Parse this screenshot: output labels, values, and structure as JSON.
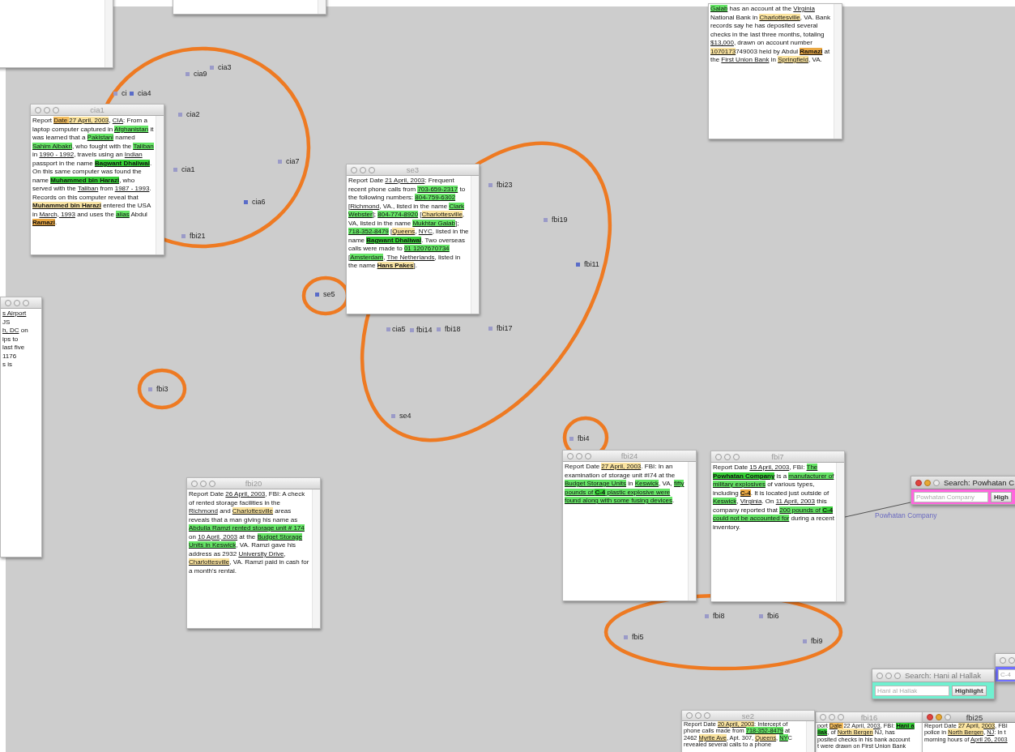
{
  "documents": [
    {
      "kind": "blank"
    },
    {
      "kind": "blank"
    },
    {
      "kind": "report",
      "segments": [
        {
          "text": "Galab",
          "kind": "green"
        },
        {
          "text": " has an account at the ",
          "kind": "plain"
        },
        {
          "text": "Virginia",
          "kind": "entity"
        },
        {
          "text": " National Bank in ",
          "kind": "plain"
        },
        {
          "text": "Charlottesville",
          "kind": "yellow"
        },
        {
          "text": ", VA. Bank records say he has deposited several checks in the last three months, totaling ",
          "kind": "plain"
        },
        {
          "text": "$13,000",
          "kind": "entity"
        },
        {
          "text": ", drawn on account number ",
          "kind": "plain"
        },
        {
          "text": "1070173",
          "kind": "yellow"
        },
        {
          "text": "749003 held by Abdul ",
          "kind": "plain"
        },
        {
          "text": "Ramazi",
          "kind": "orange-bold"
        },
        {
          "text": " at the ",
          "kind": "plain"
        },
        {
          "text": "First Union Bank",
          "kind": "entity"
        },
        {
          "text": " in ",
          "kind": "plain"
        },
        {
          "text": "Springfield",
          "kind": "yellow"
        },
        {
          "text": ", VA.",
          "kind": "plain"
        }
      ]
    },
    {
      "kind": "report",
      "title": "cia1",
      "active": false,
      "segments": [
        {
          "text": "Report ",
          "kind": "plain"
        },
        {
          "text": "Date ",
          "kind": "orange"
        },
        {
          "text": "27 April, 2003",
          "kind": "yellow"
        },
        {
          "text": ", ",
          "kind": "plain"
        },
        {
          "text": "CIA",
          "kind": "entity"
        },
        {
          "text": ": From a laptop computer captured in ",
          "kind": "plain"
        },
        {
          "text": "Afghanistan",
          "kind": "green"
        },
        {
          "text": " it was learned that a ",
          "kind": "plain"
        },
        {
          "text": "Pakistani",
          "kind": "green"
        },
        {
          "text": " named ",
          "kind": "plain"
        },
        {
          "text": "Sahim Albakri",
          "kind": "green"
        },
        {
          "text": ", who fought with the ",
          "kind": "plain"
        },
        {
          "text": "Taliban",
          "kind": "green"
        },
        {
          "text": " in ",
          "kind": "plain"
        },
        {
          "text": "1990 - 1992",
          "kind": "entity"
        },
        {
          "text": ", travels using an ",
          "kind": "plain"
        },
        {
          "text": "Indian",
          "kind": "entity"
        },
        {
          "text": " passport in the name ",
          "kind": "plain"
        },
        {
          "text": "Bagwant Dhaliwal",
          "kind": "green-bold"
        },
        {
          "text": ". On this same computer was found the name ",
          "kind": "plain"
        },
        {
          "text": "Muhammed bin Harazi",
          "kind": "green-bold"
        },
        {
          "text": ", who served with the ",
          "kind": "plain"
        },
        {
          "text": "Taliban",
          "kind": "entity"
        },
        {
          "text": " from ",
          "kind": "plain"
        },
        {
          "text": "1987 - 1993",
          "kind": "entity"
        },
        {
          "text": ". Records on this computer reveal that ",
          "kind": "plain"
        },
        {
          "text": "Muhammed bin Harazi",
          "kind": "yellow-bold"
        },
        {
          "text": " entered the USA in ",
          "kind": "plain"
        },
        {
          "text": "March, 1993",
          "kind": "entity"
        },
        {
          "text": " and uses the ",
          "kind": "plain"
        },
        {
          "text": "alias",
          "kind": "green"
        },
        {
          "text": " Abdul ",
          "kind": "plain"
        },
        {
          "text": "Ramazi",
          "kind": "orange-bold"
        },
        {
          "text": ".",
          "kind": "plain"
        }
      ]
    },
    {
      "kind": "report",
      "title": "se3",
      "active": false,
      "segments": [
        {
          "text": "Report Date ",
          "kind": "plain"
        },
        {
          "text": "21 April, 2003",
          "kind": "entity"
        },
        {
          "text": ": Frequent recent phone calls from ",
          "kind": "plain"
        },
        {
          "text": "703-659-2317",
          "kind": "green"
        },
        {
          "text": " to the following numbers: ",
          "kind": "plain"
        },
        {
          "text": "804-759-6302",
          "kind": "green"
        },
        {
          "text": " [",
          "kind": "plain"
        },
        {
          "text": "Richmond",
          "kind": "entity"
        },
        {
          "text": ", VA., listed in the name ",
          "kind": "plain"
        },
        {
          "text": "Clark Webster",
          "kind": "green"
        },
        {
          "text": "]; ",
          "kind": "plain"
        },
        {
          "text": "804-774-8920",
          "kind": "green"
        },
        {
          "text": " [",
          "kind": "plain"
        },
        {
          "text": "Charlottesville",
          "kind": "yellow"
        },
        {
          "text": ", VA, listed in the name ",
          "kind": "plain"
        },
        {
          "text": "Mukhtar Galab",
          "kind": "green"
        },
        {
          "text": "]; ",
          "kind": "plain"
        },
        {
          "text": "718-352-8479",
          "kind": "green"
        },
        {
          "text": " [",
          "kind": "plain"
        },
        {
          "text": "Queens",
          "kind": "yellow"
        },
        {
          "text": ", ",
          "kind": "plain"
        },
        {
          "text": "NYC",
          "kind": "entity"
        },
        {
          "text": ", listed in the name ",
          "kind": "plain"
        },
        {
          "text": "Bagwant Dhaliwal",
          "kind": "green-bold"
        },
        {
          "text": ". Two overseas calls were made to ",
          "kind": "plain"
        },
        {
          "text": "01 1207670734",
          "kind": "green"
        },
        {
          "text": " [",
          "kind": "plain"
        },
        {
          "text": "Amsterdam",
          "kind": "green"
        },
        {
          "text": ", ",
          "kind": "plain"
        },
        {
          "text": "The Netherlands",
          "kind": "entity"
        },
        {
          "text": ", listed in the name ",
          "kind": "plain"
        },
        {
          "text": "Hans Pakes",
          "kind": "yellow-bold"
        },
        {
          "text": "].",
          "kind": "plain"
        }
      ]
    },
    {
      "kind": "clipped",
      "active": false,
      "lines": [
        [
          {
            "text": "s Airport",
            "kind": "entity"
          }
        ],
        [
          {
            "text": "JS",
            "kind": "plain"
          }
        ],
        [
          {
            "text": "h, DC",
            "kind": "entity"
          },
          {
            "text": " on",
            "kind": "plain"
          }
        ],
        [
          {
            "text": "ips to",
            "kind": "plain"
          }
        ],
        [
          {
            "text": "last five",
            "kind": "plain"
          }
        ],
        [
          {
            "text": "1176",
            "kind": "plain"
          }
        ],
        [
          {
            "text": "s is",
            "kind": "plain"
          }
        ]
      ]
    },
    {
      "kind": "report",
      "title": "fbi20",
      "active": false,
      "segments": [
        {
          "text": "Report Date ",
          "kind": "plain"
        },
        {
          "text": "26 April, 2003",
          "kind": "entity"
        },
        {
          "text": ", FBI: A check of rented storage facilities in the ",
          "kind": "plain"
        },
        {
          "text": "Richmond",
          "kind": "entity"
        },
        {
          "text": " and ",
          "kind": "plain"
        },
        {
          "text": "Charlottesville",
          "kind": "yellow"
        },
        {
          "text": " areas reveals that a man giving his name as ",
          "kind": "plain"
        },
        {
          "text": "Abdulla Ramzi rented storage unit # 174",
          "kind": "green"
        },
        {
          "text": " on ",
          "kind": "plain"
        },
        {
          "text": "10 April, 2003",
          "kind": "entity"
        },
        {
          "text": " at the ",
          "kind": "plain"
        },
        {
          "text": "Budget Storage Units in Keswick",
          "kind": "green"
        },
        {
          "text": ", VA. Ramzi gave his address as 2932 ",
          "kind": "plain"
        },
        {
          "text": "University Drive",
          "kind": "entity"
        },
        {
          "text": ", ",
          "kind": "plain"
        },
        {
          "text": "Charlottesville",
          "kind": "yellow"
        },
        {
          "text": ", VA. Ramzi paid in cash for a month's rental.",
          "kind": "plain"
        }
      ]
    },
    {
      "kind": "report",
      "title": "fbi24",
      "active": false,
      "segments": [
        {
          "text": "Report Date ",
          "kind": "plain"
        },
        {
          "text": "27 April, 2003",
          "kind": "yellow"
        },
        {
          "text": ". FBI: In an examination of storage unit #I74 at the ",
          "kind": "plain"
        },
        {
          "text": "Budget Storage Units",
          "kind": "green"
        },
        {
          "text": " in ",
          "kind": "plain"
        },
        {
          "text": "Keswick",
          "kind": "green"
        },
        {
          "text": ", VA, ",
          "kind": "plain"
        },
        {
          "text": "fifty pounds of ",
          "kind": "green"
        },
        {
          "text": "C-4",
          "kind": "green-bold"
        },
        {
          "text": " plastic explosive were found along with some fusing devices",
          "kind": "green"
        },
        {
          "text": ".",
          "kind": "plain"
        }
      ]
    },
    {
      "kind": "report",
      "title": "fbi7",
      "active": false,
      "segments": [
        {
          "text": "Report Date ",
          "kind": "plain"
        },
        {
          "text": "15 April, 2003",
          "kind": "entity"
        },
        {
          "text": ", FBI: ",
          "kind": "plain"
        },
        {
          "text": "The ",
          "kind": "green"
        },
        {
          "text": "Powhatan Company",
          "kind": "green-bold"
        },
        {
          "text": " is a ",
          "kind": "plain"
        },
        {
          "text": "manufacturer of military explosives",
          "kind": "green"
        },
        {
          "text": " of various types, including ",
          "kind": "plain"
        },
        {
          "text": "C-4",
          "kind": "orange-bold"
        },
        {
          "text": ". It is located just outside of ",
          "kind": "plain"
        },
        {
          "text": "Keswick",
          "kind": "green"
        },
        {
          "text": ", ",
          "kind": "plain"
        },
        {
          "text": "Virginia",
          "kind": "entity"
        },
        {
          "text": ". On ",
          "kind": "plain"
        },
        {
          "text": "11 April, 2003",
          "kind": "entity"
        },
        {
          "text": " this company reported that ",
          "kind": "plain"
        },
        {
          "text": "200 pounds of ",
          "kind": "green"
        },
        {
          "text": "C-4",
          "kind": "green-bold"
        },
        {
          "text": " could not be accounted for",
          "kind": "green"
        },
        {
          "text": " during a recent inventory.",
          "kind": "plain"
        }
      ]
    },
    {
      "kind": "report",
      "title": "se2",
      "active": false,
      "segments": [
        {
          "text": "Report Date ",
          "kind": "plain"
        },
        {
          "text": "20 April, 2003",
          "kind": "yellow"
        },
        {
          "text": ": Intercept of phone calls made from ",
          "kind": "plain"
        },
        {
          "text": "718-352-8479",
          "kind": "green"
        },
        {
          "text": " at 2462 ",
          "kind": "plain"
        },
        {
          "text": "Myrtle Ave",
          "kind": "yellow"
        },
        {
          "text": ", Apt. 307, ",
          "kind": "plain"
        },
        {
          "text": "Queens",
          "kind": "yellow"
        },
        {
          "text": ", ",
          "kind": "plain"
        },
        {
          "text": "NY",
          "kind": "green"
        },
        {
          "text": "C revealed several calls to a phone",
          "kind": "plain"
        }
      ]
    },
    {
      "kind": "clipped",
      "title": "fbi16",
      "active": false,
      "lines": [
        [
          {
            "text": "port ",
            "kind": "plain"
          },
          {
            "text": "Date ",
            "kind": "orange"
          },
          {
            "text": "22 April, 2003",
            "kind": "entity"
          },
          {
            "text": ", FBI: ",
            "kind": "plain"
          },
          {
            "text": "Hani a",
            "kind": "green-bold"
          }
        ],
        [
          {
            "text": "llak",
            "kind": "green-bold"
          },
          {
            "text": ", of ",
            "kind": "plain"
          },
          {
            "text": "North Bergen",
            "kind": "yellow"
          },
          {
            "text": " NJ, has",
            "kind": "plain"
          }
        ],
        [
          {
            "text": "posited checks in his bank account",
            "kind": "plain"
          }
        ],
        [
          {
            "text": "t were drawn on First Union Bank",
            "kind": "plain"
          }
        ]
      ]
    },
    {
      "kind": "clipped",
      "title": "fbi25",
      "active": true,
      "lines": [
        [
          {
            "text": "Report Date ",
            "kind": "plain"
          },
          {
            "text": "27 April, 2003",
            "kind": "yellow"
          },
          {
            "text": ", FBI",
            "kind": "plain"
          }
        ],
        [
          {
            "text": "police in ",
            "kind": "plain"
          },
          {
            "text": "North Bergen",
            "kind": "yellow"
          },
          {
            "text": ", ",
            "kind": "plain"
          },
          {
            "text": "NJ",
            "kind": "entity"
          },
          {
            "text": ": In t",
            "kind": "plain"
          }
        ],
        [
          {
            "text": "morning hours of ",
            "kind": "plain"
          },
          {
            "text": "April 26, 2003",
            "kind": "entity"
          }
        ]
      ]
    }
  ],
  "nodes": [
    {
      "label": "cia3",
      "color": "#9a9ac8"
    },
    {
      "label": "cia9",
      "color": "#9a9ac8"
    },
    {
      "label": "ci",
      "color": "#9a9ac8"
    },
    {
      "label": "cia4",
      "color": "#5a6cc8"
    },
    {
      "label": "cia2",
      "color": "#9a9ac8"
    },
    {
      "label": "cia7",
      "color": "#9a9ac8"
    },
    {
      "label": "cia1",
      "color": "#9a9ac8"
    },
    {
      "label": "cia6",
      "color": "#5a6cc8"
    },
    {
      "label": "fbi21",
      "color": "#9a9ac8"
    },
    {
      "label": "fbi23",
      "color": "#9a9ac8"
    },
    {
      "label": "fbi19",
      "color": "#9a9ac8"
    },
    {
      "label": "fbi11",
      "color": "#5a6cc8"
    },
    {
      "label": "se5",
      "color": "#5a6cc8"
    },
    {
      "label": "cia5",
      "color": "#9a9ac8"
    },
    {
      "label": "fbi14",
      "color": "#9a9ac8"
    },
    {
      "label": "fbi18",
      "color": "#9a9ac8"
    },
    {
      "label": "fbi17",
      "color": "#9a9ac8"
    },
    {
      "label": "fbi3",
      "color": "#9a9ac8"
    },
    {
      "label": "se4",
      "color": "#9a9ac8"
    },
    {
      "label": "fbi4",
      "color": "#9a9ac8"
    },
    {
      "label": "fbi8",
      "color": "#9a9ac8"
    },
    {
      "label": "fbi6",
      "color": "#9a9ac8"
    },
    {
      "label": "fbi5",
      "color": "#9a9ac8"
    },
    {
      "label": "fbi9",
      "color": "#9a9ac8"
    }
  ],
  "search_windows": [
    {
      "title": "Search: Powhatan C",
      "placeholder": "Powhatan Company",
      "button": "High",
      "color": "#ff66dd",
      "active": true
    },
    {
      "placeholder": "C-4",
      "color": "#7070ff",
      "active": false
    },
    {
      "title": "Search: Hani al Hallak",
      "placeholder": "Hani al Hallak",
      "button": "Highlight",
      "color": "#70f0d0",
      "active": false
    }
  ],
  "links": [
    {
      "label": "Powhatan Company"
    }
  ]
}
